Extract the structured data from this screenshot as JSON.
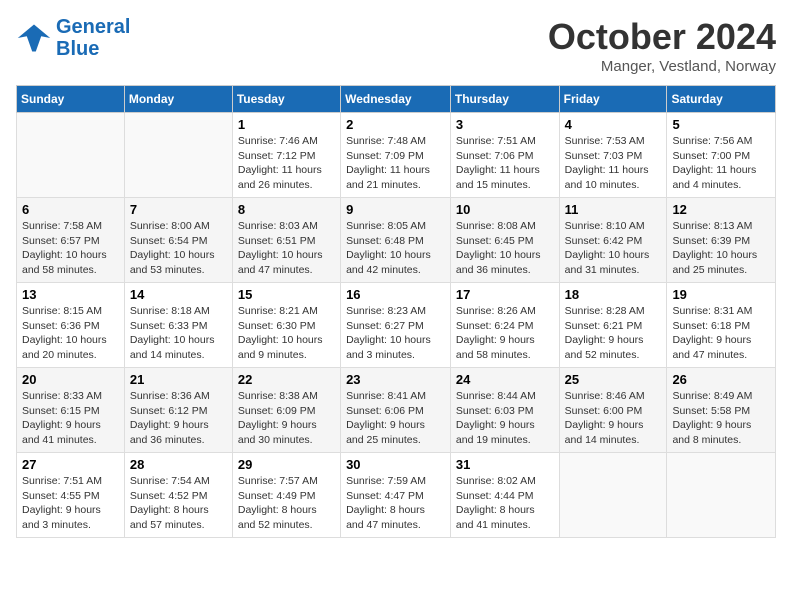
{
  "header": {
    "logo_line1": "General",
    "logo_line2": "Blue",
    "month_title": "October 2024",
    "subtitle": "Manger, Vestland, Norway"
  },
  "weekdays": [
    "Sunday",
    "Monday",
    "Tuesday",
    "Wednesday",
    "Thursday",
    "Friday",
    "Saturday"
  ],
  "weeks": [
    [
      {
        "day": "",
        "detail": ""
      },
      {
        "day": "",
        "detail": ""
      },
      {
        "day": "1",
        "detail": "Sunrise: 7:46 AM\nSunset: 7:12 PM\nDaylight: 11 hours\nand 26 minutes."
      },
      {
        "day": "2",
        "detail": "Sunrise: 7:48 AM\nSunset: 7:09 PM\nDaylight: 11 hours\nand 21 minutes."
      },
      {
        "day": "3",
        "detail": "Sunrise: 7:51 AM\nSunset: 7:06 PM\nDaylight: 11 hours\nand 15 minutes."
      },
      {
        "day": "4",
        "detail": "Sunrise: 7:53 AM\nSunset: 7:03 PM\nDaylight: 11 hours\nand 10 minutes."
      },
      {
        "day": "5",
        "detail": "Sunrise: 7:56 AM\nSunset: 7:00 PM\nDaylight: 11 hours\nand 4 minutes."
      }
    ],
    [
      {
        "day": "6",
        "detail": "Sunrise: 7:58 AM\nSunset: 6:57 PM\nDaylight: 10 hours\nand 58 minutes."
      },
      {
        "day": "7",
        "detail": "Sunrise: 8:00 AM\nSunset: 6:54 PM\nDaylight: 10 hours\nand 53 minutes."
      },
      {
        "day": "8",
        "detail": "Sunrise: 8:03 AM\nSunset: 6:51 PM\nDaylight: 10 hours\nand 47 minutes."
      },
      {
        "day": "9",
        "detail": "Sunrise: 8:05 AM\nSunset: 6:48 PM\nDaylight: 10 hours\nand 42 minutes."
      },
      {
        "day": "10",
        "detail": "Sunrise: 8:08 AM\nSunset: 6:45 PM\nDaylight: 10 hours\nand 36 minutes."
      },
      {
        "day": "11",
        "detail": "Sunrise: 8:10 AM\nSunset: 6:42 PM\nDaylight: 10 hours\nand 31 minutes."
      },
      {
        "day": "12",
        "detail": "Sunrise: 8:13 AM\nSunset: 6:39 PM\nDaylight: 10 hours\nand 25 minutes."
      }
    ],
    [
      {
        "day": "13",
        "detail": "Sunrise: 8:15 AM\nSunset: 6:36 PM\nDaylight: 10 hours\nand 20 minutes."
      },
      {
        "day": "14",
        "detail": "Sunrise: 8:18 AM\nSunset: 6:33 PM\nDaylight: 10 hours\nand 14 minutes."
      },
      {
        "day": "15",
        "detail": "Sunrise: 8:21 AM\nSunset: 6:30 PM\nDaylight: 10 hours\nand 9 minutes."
      },
      {
        "day": "16",
        "detail": "Sunrise: 8:23 AM\nSunset: 6:27 PM\nDaylight: 10 hours\nand 3 minutes."
      },
      {
        "day": "17",
        "detail": "Sunrise: 8:26 AM\nSunset: 6:24 PM\nDaylight: 9 hours\nand 58 minutes."
      },
      {
        "day": "18",
        "detail": "Sunrise: 8:28 AM\nSunset: 6:21 PM\nDaylight: 9 hours\nand 52 minutes."
      },
      {
        "day": "19",
        "detail": "Sunrise: 8:31 AM\nSunset: 6:18 PM\nDaylight: 9 hours\nand 47 minutes."
      }
    ],
    [
      {
        "day": "20",
        "detail": "Sunrise: 8:33 AM\nSunset: 6:15 PM\nDaylight: 9 hours\nand 41 minutes."
      },
      {
        "day": "21",
        "detail": "Sunrise: 8:36 AM\nSunset: 6:12 PM\nDaylight: 9 hours\nand 36 minutes."
      },
      {
        "day": "22",
        "detail": "Sunrise: 8:38 AM\nSunset: 6:09 PM\nDaylight: 9 hours\nand 30 minutes."
      },
      {
        "day": "23",
        "detail": "Sunrise: 8:41 AM\nSunset: 6:06 PM\nDaylight: 9 hours\nand 25 minutes."
      },
      {
        "day": "24",
        "detail": "Sunrise: 8:44 AM\nSunset: 6:03 PM\nDaylight: 9 hours\nand 19 minutes."
      },
      {
        "day": "25",
        "detail": "Sunrise: 8:46 AM\nSunset: 6:00 PM\nDaylight: 9 hours\nand 14 minutes."
      },
      {
        "day": "26",
        "detail": "Sunrise: 8:49 AM\nSunset: 5:58 PM\nDaylight: 9 hours\nand 8 minutes."
      }
    ],
    [
      {
        "day": "27",
        "detail": "Sunrise: 7:51 AM\nSunset: 4:55 PM\nDaylight: 9 hours\nand 3 minutes."
      },
      {
        "day": "28",
        "detail": "Sunrise: 7:54 AM\nSunset: 4:52 PM\nDaylight: 8 hours\nand 57 minutes."
      },
      {
        "day": "29",
        "detail": "Sunrise: 7:57 AM\nSunset: 4:49 PM\nDaylight: 8 hours\nand 52 minutes."
      },
      {
        "day": "30",
        "detail": "Sunrise: 7:59 AM\nSunset: 4:47 PM\nDaylight: 8 hours\nand 47 minutes."
      },
      {
        "day": "31",
        "detail": "Sunrise: 8:02 AM\nSunset: 4:44 PM\nDaylight: 8 hours\nand 41 minutes."
      },
      {
        "day": "",
        "detail": ""
      },
      {
        "day": "",
        "detail": ""
      }
    ]
  ]
}
